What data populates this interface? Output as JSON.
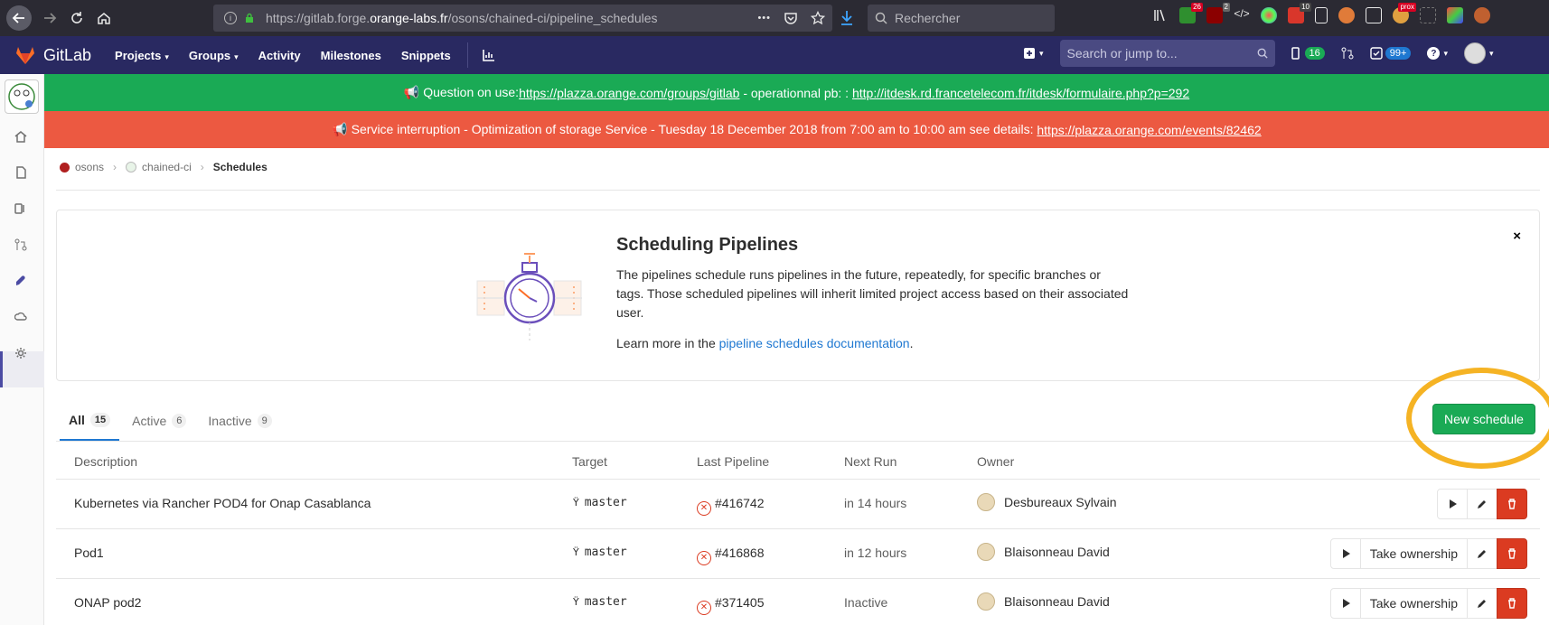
{
  "browser": {
    "url_prefix": "https://gitlab.forge.",
    "url_domain": "orange-labs.fr",
    "url_path": "/osons/chained-ci/pipeline_schedules",
    "search_placeholder": "Rechercher",
    "more_label": "•••",
    "badge_red": "26",
    "badge_gray": "2",
    "badge_ten": "10",
    "badge_prox": "prox"
  },
  "header": {
    "brand": "GitLab",
    "nav": [
      "Projects",
      "Groups",
      "Activity",
      "Milestones",
      "Snippets"
    ],
    "search_placeholder": "Search or jump to...",
    "issues_count": "16",
    "todos_count": "99+"
  },
  "banners": {
    "green_text": "📢 Question on use: ",
    "green_link1": "https://plazza.orange.com/groups/gitlab",
    "green_mid": " - operationnal pb: : ",
    "green_link2": "http://itdesk.rd.francetelecom.fr/itdesk/formulaire.php?p=292",
    "red_text": "📢 Service interruption - Optimization of storage Service - Tuesday 18 December 2018 from 7:00 am to 10:00 am see details: ",
    "red_link": "https://plazza.orange.com/events/82462"
  },
  "breadcrumb": {
    "group": "osons",
    "project": "chained-ci",
    "current": "Schedules"
  },
  "info": {
    "title": "Scheduling Pipelines",
    "text": "The pipelines schedule runs pipelines in the future, repeatedly, for specific branches or tags. Those scheduled pipelines will inherit limited project access based on their associated user.",
    "learn_prefix": "Learn more in the ",
    "learn_link": "pipeline schedules documentation",
    "learn_suffix": ".",
    "close": "×"
  },
  "tabs": [
    {
      "label": "All",
      "count": "15"
    },
    {
      "label": "Active",
      "count": "6"
    },
    {
      "label": "Inactive",
      "count": "9"
    }
  ],
  "new_schedule": "New schedule",
  "table": {
    "headers": [
      "Description",
      "Target",
      "Last Pipeline",
      "Next Run",
      "Owner"
    ],
    "rows": [
      {
        "description": "Kubernetes via Rancher POD4 for Onap Casablanca",
        "target": "master",
        "pipeline": "#416742",
        "next_run": "in 14 hours",
        "owner": "Desbureaux Sylvain",
        "take_ownership": ""
      },
      {
        "description": "Pod1",
        "target": "master",
        "pipeline": "#416868",
        "next_run": "in 12 hours",
        "owner": "Blaisonneau David",
        "take_ownership": "Take ownership"
      },
      {
        "description": "ONAP pod2",
        "target": "master",
        "pipeline": "#371405",
        "next_run": "Inactive",
        "owner": "Blaisonneau David",
        "take_ownership": "Take ownership"
      }
    ]
  },
  "colors": {
    "header_bg": "#292961",
    "green": "#1aaa55",
    "red_banner": "#ec5941",
    "danger": "#db3b21",
    "link": "#1f78d1",
    "highlight": "#f5b324"
  }
}
